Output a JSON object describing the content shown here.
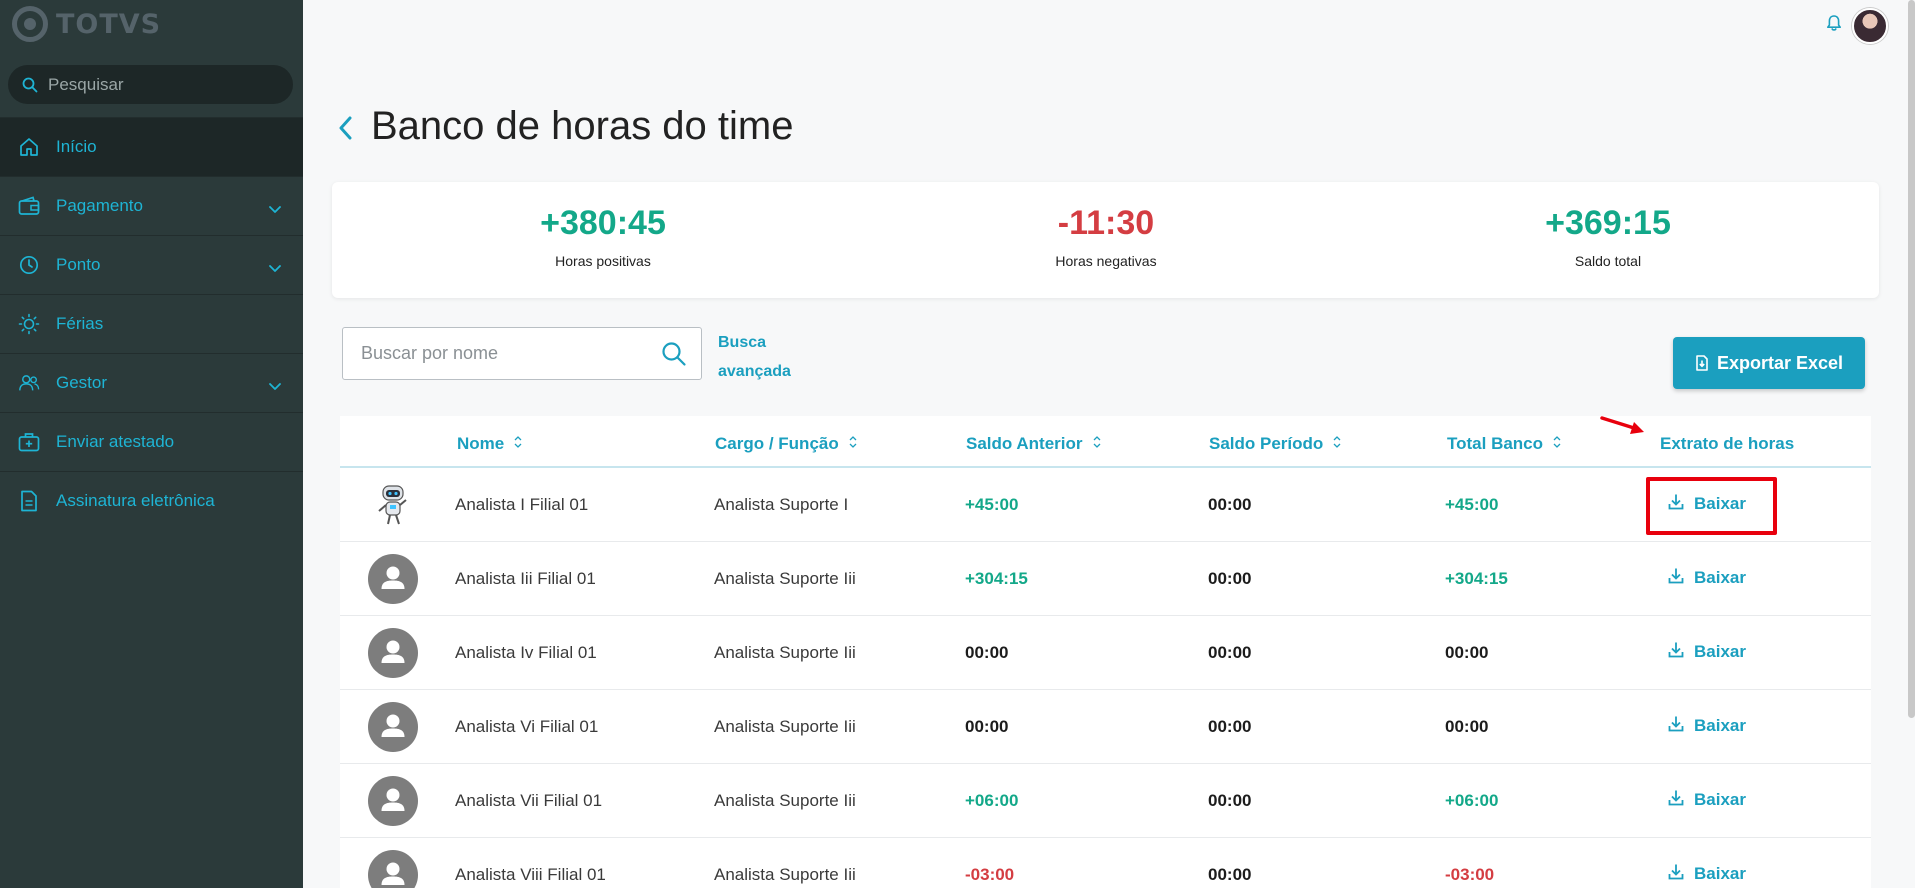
{
  "app": {
    "logo_text": "TOTVS"
  },
  "sidebar": {
    "search_placeholder": "Pesquisar",
    "items": [
      {
        "label": "Início",
        "icon": "home-icon",
        "expandable": false,
        "active": true
      },
      {
        "label": "Pagamento",
        "icon": "wallet-icon",
        "expandable": true
      },
      {
        "label": "Ponto",
        "icon": "clock-icon",
        "expandable": true
      },
      {
        "label": "Férias",
        "icon": "sun-icon",
        "expandable": false
      },
      {
        "label": "Gestor",
        "icon": "users-icon",
        "expandable": true
      },
      {
        "label": "Enviar atestado",
        "icon": "medical-bag-icon",
        "expandable": false
      },
      {
        "label": "Assinatura eletrônica",
        "icon": "document-icon",
        "expandable": false
      }
    ]
  },
  "page": {
    "title": "Banco de horas do time"
  },
  "summary": {
    "positive": {
      "value": "+380:45",
      "label": "Horas positivas"
    },
    "negative": {
      "value": "-11:30",
      "label": "Horas negativas"
    },
    "total": {
      "value": "+369:15",
      "label": "Saldo total"
    }
  },
  "filters": {
    "search_placeholder": "Buscar por nome",
    "advanced_line1": "Busca",
    "advanced_line2": "avançada",
    "export_label": "Exportar Excel"
  },
  "table": {
    "columns": {
      "nome": "Nome",
      "cargo": "Cargo / Função",
      "saldo_anterior": "Saldo Anterior",
      "saldo_periodo": "Saldo Período",
      "total_banco": "Total Banco",
      "extrato": "Extrato de horas"
    },
    "download_label": "Baixar",
    "rows": [
      {
        "nome": "Analista I Filial 01",
        "cargo": "Analista Suporte I",
        "saldo_anterior": "+45:00",
        "saldo_periodo": "00:00",
        "total_banco": "+45:00",
        "avatar": "robot"
      },
      {
        "nome": "Analista Iii Filial 01",
        "cargo": "Analista Suporte Iii",
        "saldo_anterior": "+304:15",
        "saldo_periodo": "00:00",
        "total_banco": "+304:15",
        "avatar": "default"
      },
      {
        "nome": "Analista Iv Filial 01",
        "cargo": "Analista Suporte Iii",
        "saldo_anterior": "00:00",
        "saldo_periodo": "00:00",
        "total_banco": "00:00",
        "avatar": "default"
      },
      {
        "nome": "Analista Vi Filial 01",
        "cargo": "Analista Suporte Iii",
        "saldo_anterior": "00:00",
        "saldo_periodo": "00:00",
        "total_banco": "00:00",
        "avatar": "default"
      },
      {
        "nome": "Analista Vii Filial 01",
        "cargo": "Analista Suporte Iii",
        "saldo_anterior": "+06:00",
        "saldo_periodo": "00:00",
        "total_banco": "+06:00",
        "avatar": "default"
      },
      {
        "nome": "Analista Viii Filial 01",
        "cargo": "Analista Suporte Iii",
        "saldo_anterior": "-03:00",
        "saldo_periodo": "00:00",
        "total_banco": "-03:00",
        "avatar": "default"
      }
    ]
  },
  "colors": {
    "accent": "#1b9fbf",
    "positive": "#13a889",
    "negative": "#d43d42",
    "sidebar_bg": "#2b3a3a",
    "annotation": "#e8000d"
  }
}
